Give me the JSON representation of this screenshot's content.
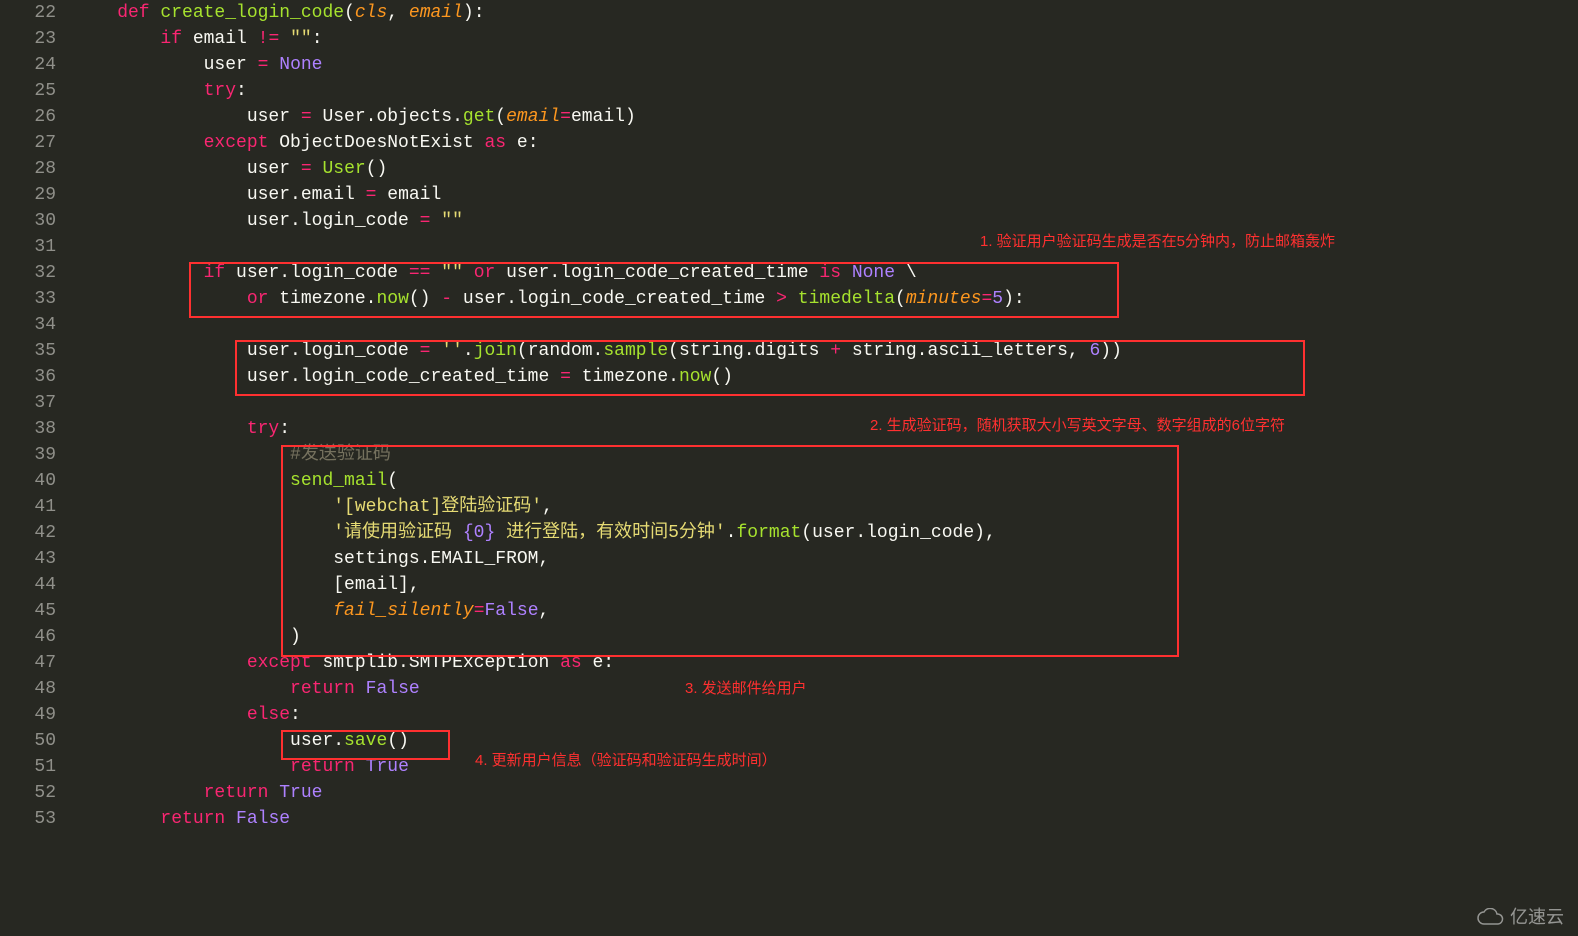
{
  "line_numbers": [
    "22",
    "23",
    "24",
    "25",
    "26",
    "27",
    "28",
    "29",
    "30",
    "31",
    "32",
    "33",
    "34",
    "35",
    "36",
    "37",
    "38",
    "39",
    "40",
    "41",
    "42",
    "43",
    "44",
    "45",
    "46",
    "47",
    "48",
    "49",
    "50",
    "51",
    "52",
    "53"
  ],
  "code_lines": {
    "22": [
      [
        "kw",
        "    def "
      ],
      [
        "decl",
        "create_login_code"
      ],
      [
        "pun",
        "("
      ],
      [
        "arg",
        "cls"
      ],
      [
        "pun",
        ", "
      ],
      [
        "arg",
        "email"
      ],
      [
        "pun",
        "):"
      ]
    ],
    "23": [
      [
        "var",
        "        "
      ],
      [
        "kw",
        "if"
      ],
      [
        "var",
        " email "
      ],
      [
        "op",
        "!="
      ],
      [
        "var",
        " "
      ],
      [
        "str",
        "\"\""
      ],
      [
        "pun",
        ":"
      ]
    ],
    "24": [
      [
        "var",
        "            user "
      ],
      [
        "op",
        "="
      ],
      [
        "var",
        " "
      ],
      [
        "num",
        "None"
      ]
    ],
    "25": [
      [
        "var",
        "            "
      ],
      [
        "kw",
        "try"
      ],
      [
        "pun",
        ":"
      ]
    ],
    "26": [
      [
        "var",
        "                user "
      ],
      [
        "op",
        "="
      ],
      [
        "var",
        " User.objects."
      ],
      [
        "fn",
        "get"
      ],
      [
        "pun",
        "("
      ],
      [
        "arg",
        "email"
      ],
      [
        "op",
        "="
      ],
      [
        "var",
        "email"
      ],
      [
        "pun",
        ")"
      ]
    ],
    "27": [
      [
        "var",
        "            "
      ],
      [
        "kw",
        "except"
      ],
      [
        "var",
        " ObjectDoesNotExist "
      ],
      [
        "kw",
        "as"
      ],
      [
        "var",
        " e"
      ],
      [
        "pun",
        ":"
      ]
    ],
    "28": [
      [
        "var",
        "                user "
      ],
      [
        "op",
        "="
      ],
      [
        "var",
        " "
      ],
      [
        "fn",
        "User"
      ],
      [
        "pun",
        "()"
      ]
    ],
    "29": [
      [
        "var",
        "                user.email "
      ],
      [
        "op",
        "="
      ],
      [
        "var",
        " email"
      ]
    ],
    "30": [
      [
        "var",
        "                user.login_code "
      ],
      [
        "op",
        "="
      ],
      [
        "var",
        " "
      ],
      [
        "str",
        "\"\""
      ]
    ],
    "31": [
      [
        "var",
        ""
      ]
    ],
    "32": [
      [
        "var",
        "            "
      ],
      [
        "kw",
        "if"
      ],
      [
        "var",
        " user.login_code "
      ],
      [
        "op",
        "=="
      ],
      [
        "var",
        " "
      ],
      [
        "str",
        "\"\""
      ],
      [
        "var",
        " "
      ],
      [
        "kw",
        "or"
      ],
      [
        "var",
        " user.login_code_created_time "
      ],
      [
        "kw",
        "is"
      ],
      [
        "var",
        " "
      ],
      [
        "num",
        "None"
      ],
      [
        "var",
        " \\"
      ]
    ],
    "33": [
      [
        "var",
        "                "
      ],
      [
        "kw",
        "or"
      ],
      [
        "var",
        " timezone."
      ],
      [
        "fn",
        "now"
      ],
      [
        "pun",
        "()"
      ],
      [
        "var",
        " "
      ],
      [
        "op",
        "-"
      ],
      [
        "var",
        " user.login_code_created_time "
      ],
      [
        "op",
        ">"
      ],
      [
        "var",
        " "
      ],
      [
        "fn",
        "timedelta"
      ],
      [
        "pun",
        "("
      ],
      [
        "arg",
        "minutes"
      ],
      [
        "op",
        "="
      ],
      [
        "num",
        "5"
      ],
      [
        "pun",
        "):"
      ]
    ],
    "34": [
      [
        "var",
        ""
      ]
    ],
    "35": [
      [
        "var",
        "                user.login_code "
      ],
      [
        "op",
        "="
      ],
      [
        "var",
        " "
      ],
      [
        "str",
        "''"
      ],
      [
        "var",
        "."
      ],
      [
        "fn",
        "join"
      ],
      [
        "pun",
        "("
      ],
      [
        "var",
        "random."
      ],
      [
        "fn",
        "sample"
      ],
      [
        "pun",
        "("
      ],
      [
        "var",
        "string.digits "
      ],
      [
        "op",
        "+"
      ],
      [
        "var",
        " string.ascii_letters, "
      ],
      [
        "num",
        "6"
      ],
      [
        "pun",
        "))"
      ]
    ],
    "36": [
      [
        "var",
        "                user.login_code_created_time "
      ],
      [
        "op",
        "="
      ],
      [
        "var",
        " timezone."
      ],
      [
        "fn",
        "now"
      ],
      [
        "pun",
        "()"
      ]
    ],
    "37": [
      [
        "var",
        ""
      ]
    ],
    "38": [
      [
        "var",
        "                "
      ],
      [
        "kw",
        "try"
      ],
      [
        "pun",
        ":"
      ]
    ],
    "39": [
      [
        "var",
        "                    "
      ],
      [
        "cmt",
        "#发送验证码"
      ]
    ],
    "40": [
      [
        "var",
        "                    "
      ],
      [
        "fn",
        "send_mail"
      ],
      [
        "pun",
        "("
      ]
    ],
    "41": [
      [
        "var",
        "                        "
      ],
      [
        "str",
        "'[webchat]登陆验证码'"
      ],
      [
        "pun",
        ","
      ]
    ],
    "42": [
      [
        "var",
        "                        "
      ],
      [
        "str",
        "'请使用验证码 "
      ],
      [
        "num",
        "{0}"
      ],
      [
        "str",
        " 进行登陆，有效时间5分钟'"
      ],
      [
        "var",
        "."
      ],
      [
        "fn",
        "format"
      ],
      [
        "pun",
        "("
      ],
      [
        "var",
        "user.login_code"
      ],
      [
        "pun",
        "),"
      ]
    ],
    "43": [
      [
        "var",
        "                        settings.EMAIL_FROM,"
      ]
    ],
    "44": [
      [
        "var",
        "                        [email],"
      ]
    ],
    "45": [
      [
        "var",
        "                        "
      ],
      [
        "arg",
        "fail_silently"
      ],
      [
        "op",
        "="
      ],
      [
        "num",
        "False"
      ],
      [
        "pun",
        ","
      ]
    ],
    "46": [
      [
        "var",
        "                    )"
      ]
    ],
    "47": [
      [
        "var",
        "                "
      ],
      [
        "kw",
        "except"
      ],
      [
        "var",
        " smtplib.SMTPException "
      ],
      [
        "kw",
        "as"
      ],
      [
        "var",
        " e:"
      ]
    ],
    "48": [
      [
        "var",
        "                    "
      ],
      [
        "kw",
        "return"
      ],
      [
        "var",
        " "
      ],
      [
        "num",
        "False"
      ]
    ],
    "49": [
      [
        "var",
        "                "
      ],
      [
        "kw",
        "else"
      ],
      [
        "pun",
        ":"
      ]
    ],
    "50": [
      [
        "var",
        "                    user."
      ],
      [
        "fn",
        "save"
      ],
      [
        "pun",
        "()"
      ]
    ],
    "51": [
      [
        "var",
        "                    "
      ],
      [
        "kw",
        "return"
      ],
      [
        "var",
        " "
      ],
      [
        "num",
        "True"
      ]
    ],
    "52": [
      [
        "var",
        "            "
      ],
      [
        "kw",
        "return"
      ],
      [
        "var",
        " "
      ],
      [
        "num",
        "True"
      ]
    ],
    "53": [
      [
        "var",
        "        "
      ],
      [
        "kw",
        "return"
      ],
      [
        "var",
        " "
      ],
      [
        "num",
        "False"
      ]
    ]
  },
  "annotations": {
    "a1": "1. 验证用户验证码生成是否在5分钟内，防止邮箱轰炸",
    "a2": "2. 生成验证码，随机获取大小写英文字母、数字组成的6位字符",
    "a3": "3. 发送邮件给用户",
    "a4": "4. 更新用户信息（验证码和验证码生成时间）"
  },
  "watermark": "亿速云"
}
